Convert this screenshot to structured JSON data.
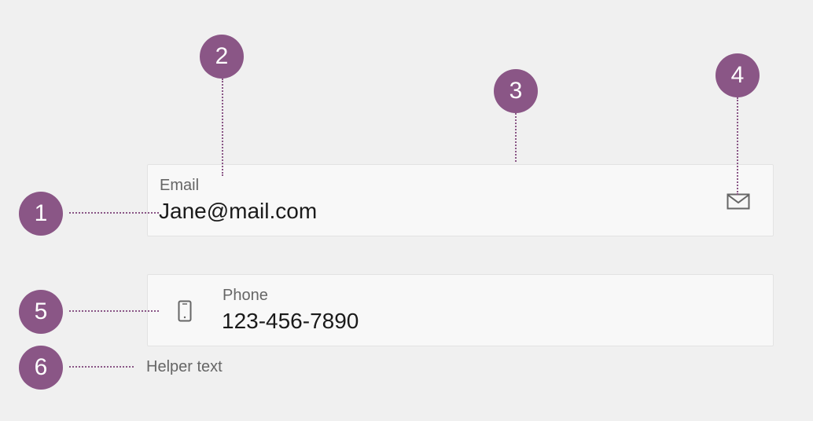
{
  "email_field": {
    "label": "Email",
    "value": "Jane@mail.com",
    "trailing_icon": "envelope-icon"
  },
  "phone_field": {
    "label": "Phone",
    "value": "123-456-7890",
    "leading_icon": "mobile-phone-icon",
    "helper_text": "Helper text"
  },
  "callouts": [
    "1",
    "2",
    "3",
    "4",
    "5",
    "6"
  ],
  "colors": {
    "callout": "#8a5686",
    "background": "#f0f0f0",
    "field": "#f8f8f8"
  }
}
